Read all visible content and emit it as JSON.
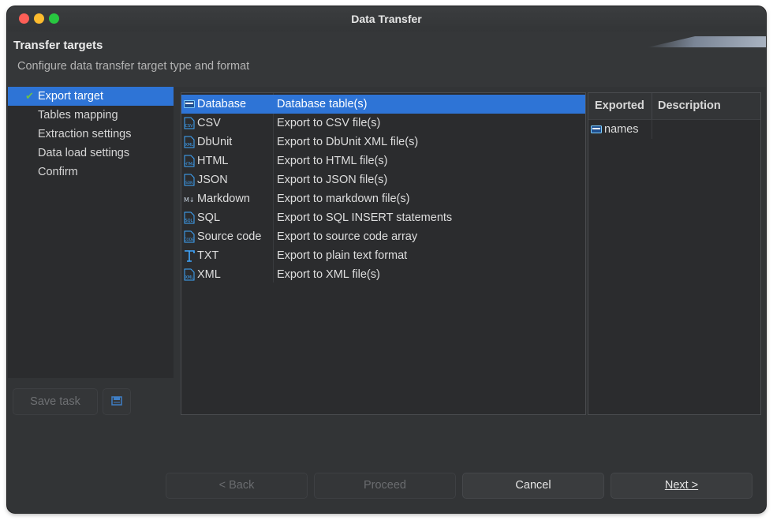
{
  "window": {
    "title": "Data Transfer"
  },
  "header": {
    "title": "Transfer targets",
    "subtitle": "Configure data transfer target type and format"
  },
  "steps": [
    {
      "label": "Export target",
      "selected": true,
      "checked": true
    },
    {
      "label": "Tables mapping"
    },
    {
      "label": "Extraction settings"
    },
    {
      "label": "Data load settings"
    },
    {
      "label": "Confirm"
    }
  ],
  "left_buttons": {
    "save_task": "Save task",
    "icon": "save-task-icon"
  },
  "targets": [
    {
      "name": "Database",
      "description": "Database table(s)",
      "icon": "database-icon",
      "selected": true
    },
    {
      "name": "CSV",
      "description": "Export to CSV file(s)",
      "icon": "csv-file-icon"
    },
    {
      "name": "DbUnit",
      "description": "Export to DbUnit XML file(s)",
      "icon": "xml-file-icon"
    },
    {
      "name": "HTML",
      "description": "Export to HTML file(s)",
      "icon": "html-file-icon"
    },
    {
      "name": "JSON",
      "description": "Export to JSON file(s)",
      "icon": "json-file-icon"
    },
    {
      "name": "Markdown",
      "description": "Export to markdown file(s)",
      "icon": "markdown-icon"
    },
    {
      "name": "SQL",
      "description": "Export to SQL INSERT statements",
      "icon": "sql-file-icon"
    },
    {
      "name": "Source code",
      "description": "Export to source code array",
      "icon": "code-file-icon"
    },
    {
      "name": "TXT",
      "description": "Export to plain text format",
      "icon": "text-icon"
    },
    {
      "name": "XML",
      "description": "Export to XML file(s)",
      "icon": "xml-file-icon"
    }
  ],
  "exported": {
    "col_exported": "Exported",
    "col_description": "Description",
    "rows": [
      {
        "name": "names",
        "description": "",
        "icon": "table-icon"
      }
    ]
  },
  "footer": {
    "back": "< Back",
    "proceed": "Proceed",
    "cancel": "Cancel",
    "next": "Next >"
  },
  "colors": {
    "selection": "#2e74d6",
    "check": "#6cc04a",
    "icon_blue": "#3fa7ff"
  }
}
